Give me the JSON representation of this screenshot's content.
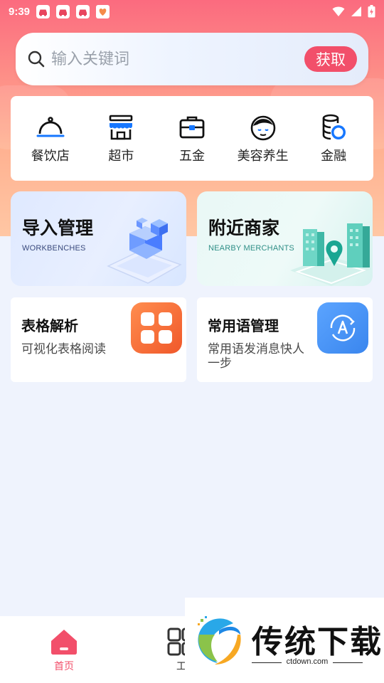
{
  "status": {
    "time": "9:39",
    "apps": [
      "driving-app-icon",
      "driving-app-icon",
      "driving-app-icon",
      "heart-app-icon"
    ],
    "right_icons": [
      "wifi-icon",
      "signal-icon",
      "battery-icon"
    ]
  },
  "search": {
    "placeholder": "输入关键词",
    "button_label": "获取"
  },
  "categories": [
    {
      "label": "餐饮店",
      "icon": "cloche-icon"
    },
    {
      "label": "超市",
      "icon": "storefront-icon"
    },
    {
      "label": "五金",
      "icon": "toolbox-icon"
    },
    {
      "label": "美容养生",
      "icon": "face-icon"
    },
    {
      "label": "金融",
      "icon": "coins-icon"
    }
  ],
  "features": {
    "import": {
      "title": "导入管理",
      "subtitle": "WORKBENCHES"
    },
    "nearby": {
      "title": "附近商家",
      "subtitle": "NEARBY MERCHANTS"
    }
  },
  "tools": {
    "table": {
      "title": "表格解析",
      "desc": "可视化表格阅读"
    },
    "phrases": {
      "title": "常用语管理",
      "desc": "常用语发消息快人一步"
    }
  },
  "tabbar": {
    "home_label": "首页",
    "second_label_partial": "工"
  },
  "watermark": {
    "text": "传统下载",
    "url": "ctdown.com"
  },
  "colors": {
    "accent": "#f24f6a",
    "category_icon": "#1677ff",
    "table_icon": "#f46a2c",
    "phrase_icon": "#3d8ef2"
  }
}
